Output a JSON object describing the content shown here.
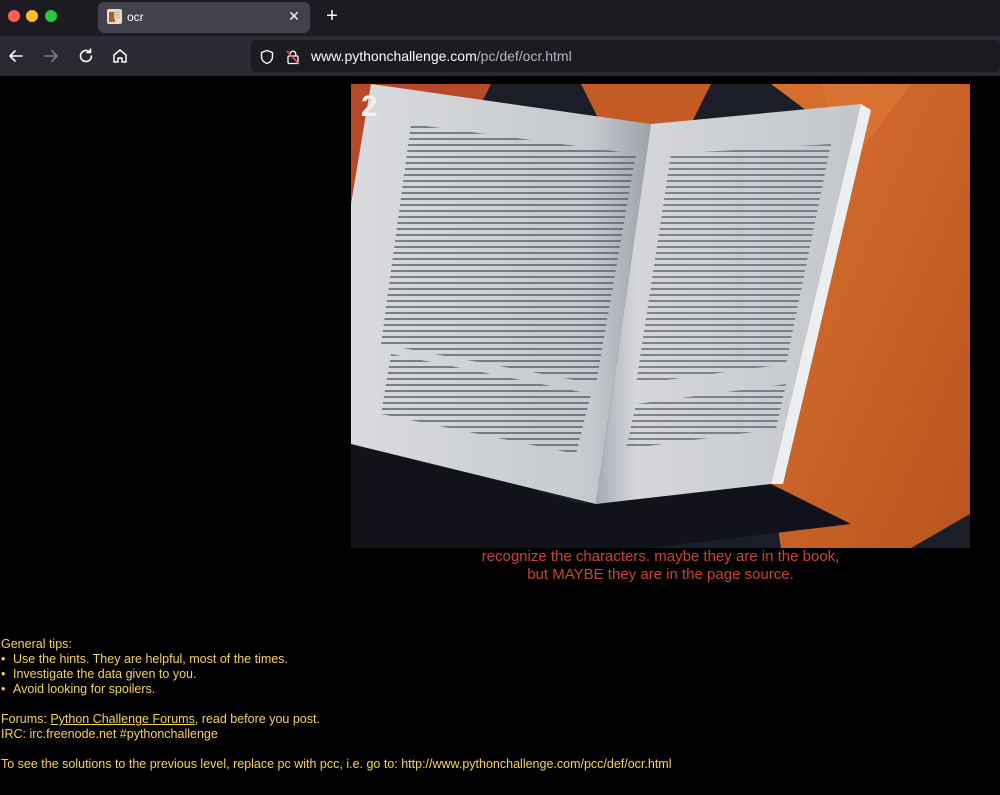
{
  "browser": {
    "tab_title": "ocr",
    "url_host": "www.pythonchallenge.com",
    "url_path": "/pc/def/ocr.html"
  },
  "page": {
    "page_number_label": "2",
    "hint_line1": "recognize the characters. maybe they are in the book,",
    "hint_line2": "but MAYBE they are in the page source.",
    "tips_heading": "General tips:",
    "tips": [
      "Use the hints. They are helpful, most of the times.",
      "Investigate the data given to you.",
      "Avoid looking for spoilers."
    ],
    "forums_prefix": "Forums: ",
    "forums_link": "Python Challenge Forums",
    "forums_suffix": ", read before you post.",
    "irc": "IRC: irc.freenode.net #pythonchallenge",
    "solutions_text": "To see the solutions to the previous level, replace pc with pcc, i.e. go to: http://www.pythonchallenge.com/pcc/def/ocr.html"
  },
  "colors": {
    "hint": "#c8452f",
    "tips": "#f6d15b",
    "background": "#000000"
  }
}
